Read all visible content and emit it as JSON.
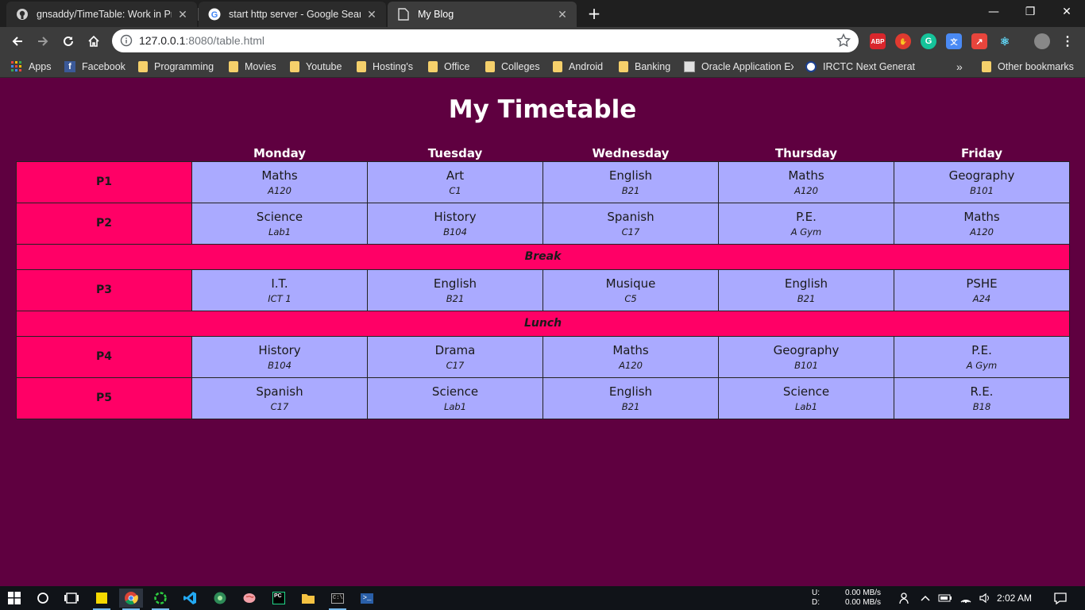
{
  "browser": {
    "tabs": [
      {
        "title": "gnsaddy/TimeTable: Work in Progress",
        "favicon": "github-icon"
      },
      {
        "title": "start http server - Google Search",
        "favicon": "google-icon"
      },
      {
        "title": "My Blog",
        "favicon": "page-icon"
      }
    ],
    "url_host": "127.0.0.1",
    "url_rest": ":8080/table.html",
    "bookmarks": [
      "Apps",
      "Facebook",
      "Programming",
      "Movies",
      "Youtube",
      "Hosting's",
      "Office",
      "Colleges",
      "Android",
      "Banking",
      "Oracle Application Ex",
      "IRCTC Next Generatio",
      "»",
      "Other bookmarks"
    ],
    "extensions": {
      "abp": "ABP"
    }
  },
  "page": {
    "title": "My Timetable",
    "days": [
      "Monday",
      "Tuesday",
      "Wednesday",
      "Thursday",
      "Friday"
    ],
    "rows": [
      {
        "type": "period",
        "label": "P1",
        "lessons": [
          {
            "subject": "Maths",
            "room": "A120"
          },
          {
            "subject": "Art",
            "room": "C1"
          },
          {
            "subject": "English",
            "room": "B21"
          },
          {
            "subject": "Maths",
            "room": "A120"
          },
          {
            "subject": "Geography",
            "room": "B101"
          }
        ]
      },
      {
        "type": "period",
        "label": "P2",
        "lessons": [
          {
            "subject": "Science",
            "room": "Lab1"
          },
          {
            "subject": "History",
            "room": "B104"
          },
          {
            "subject": "Spanish",
            "room": "C17"
          },
          {
            "subject": "P.E.",
            "room": "A Gym"
          },
          {
            "subject": "Maths",
            "room": "A120"
          }
        ]
      },
      {
        "type": "break",
        "label": "Break"
      },
      {
        "type": "period",
        "label": "P3",
        "lessons": [
          {
            "subject": "I.T.",
            "room": "ICT 1"
          },
          {
            "subject": "English",
            "room": "B21"
          },
          {
            "subject": "Musique",
            "room": "C5"
          },
          {
            "subject": "English",
            "room": "B21"
          },
          {
            "subject": "PSHE",
            "room": "A24"
          }
        ]
      },
      {
        "type": "break",
        "label": "Lunch"
      },
      {
        "type": "period",
        "label": "P4",
        "lessons": [
          {
            "subject": "History",
            "room": "B104"
          },
          {
            "subject": "Drama",
            "room": "C17"
          },
          {
            "subject": "Maths",
            "room": "A120"
          },
          {
            "subject": "Geography",
            "room": "B101"
          },
          {
            "subject": "P.E.",
            "room": "A Gym"
          }
        ]
      },
      {
        "type": "period",
        "label": "P5",
        "lessons": [
          {
            "subject": "Spanish",
            "room": "C17"
          },
          {
            "subject": "Science",
            "room": "Lab1"
          },
          {
            "subject": "English",
            "room": "B21"
          },
          {
            "subject": "Science",
            "room": "Lab1"
          },
          {
            "subject": "R.E.",
            "room": "B18"
          }
        ]
      }
    ]
  },
  "taskbar": {
    "net_up_label": "U:",
    "net_up": "0.00 MB/s",
    "net_down_label": "D:",
    "net_down": "0.00 MB/s",
    "clock": "2:02 AM"
  },
  "colors": {
    "page_bg": "#5f0040",
    "period_cell": "#ff0066",
    "lesson_cell": "#aaaaff"
  }
}
